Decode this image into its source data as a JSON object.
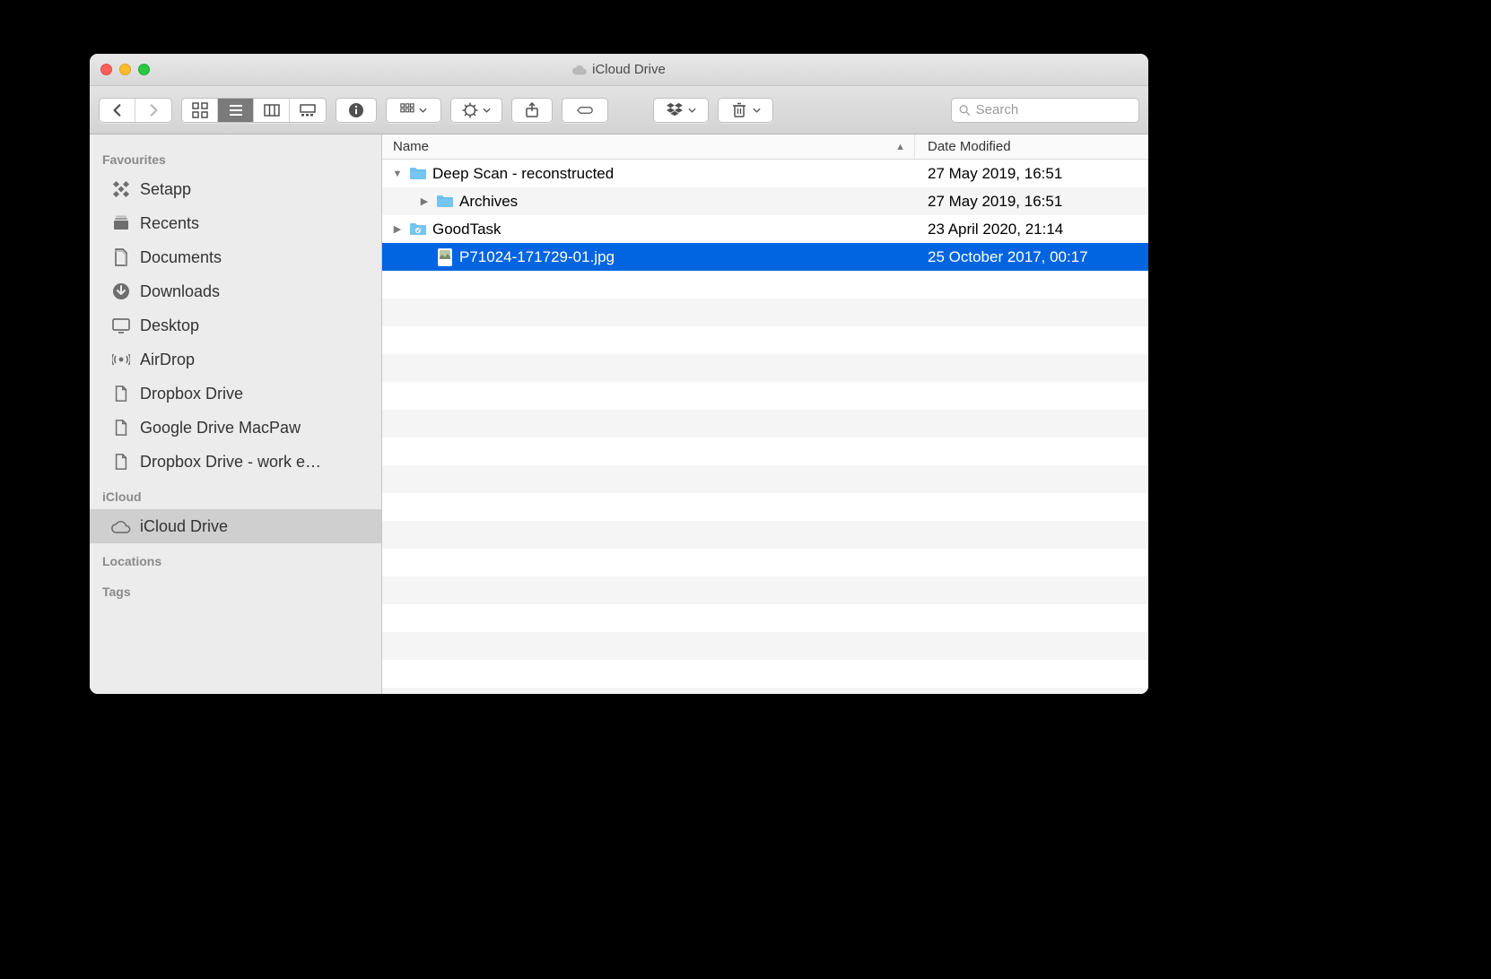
{
  "window": {
    "title": "iCloud Drive"
  },
  "toolbar": {
    "search_placeholder": "Search"
  },
  "sidebar": {
    "sections": [
      {
        "header": "Favourites",
        "items": [
          {
            "label": "Setapp",
            "icon": "setapp"
          },
          {
            "label": "Recents",
            "icon": "recents"
          },
          {
            "label": "Documents",
            "icon": "documents"
          },
          {
            "label": "Downloads",
            "icon": "downloads"
          },
          {
            "label": "Desktop",
            "icon": "desktop"
          },
          {
            "label": "AirDrop",
            "icon": "airdrop"
          },
          {
            "label": "Dropbox Drive",
            "icon": "file"
          },
          {
            "label": "Google Drive MacPaw",
            "icon": "file"
          },
          {
            "label": "Dropbox Drive - work e…",
            "icon": "file"
          }
        ]
      },
      {
        "header": "iCloud",
        "items": [
          {
            "label": "iCloud Drive",
            "icon": "icloud",
            "selected": true
          }
        ]
      },
      {
        "header": "Locations",
        "items": []
      },
      {
        "header": "Tags",
        "items": []
      }
    ]
  },
  "columns": {
    "name": "Name",
    "date": "Date Modified",
    "sort_ascending": true
  },
  "rows": [
    {
      "name": "Deep Scan - reconstructed",
      "date": "27 May 2019, 16:51",
      "type": "folder",
      "indent": 0,
      "expanded": true
    },
    {
      "name": "Archives",
      "date": "27 May 2019, 16:51",
      "type": "folder",
      "indent": 1,
      "expanded": false
    },
    {
      "name": "GoodTask",
      "date": "23 April 2020, 21:14",
      "type": "app-folder",
      "indent": 0,
      "expanded": false
    },
    {
      "name": "P71024-171729-01.jpg",
      "date": "25 October 2017, 00:17",
      "type": "image",
      "indent": 1,
      "selected": true
    }
  ]
}
